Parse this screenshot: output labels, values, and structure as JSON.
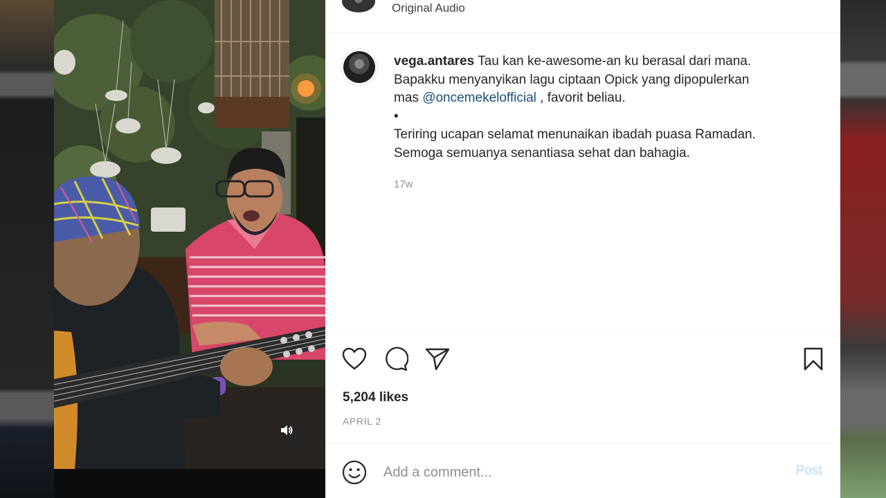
{
  "header": {
    "audio_label": "Original Audio"
  },
  "caption": {
    "username": "vega.antares",
    "line1": " Tau kan ke-awesome-an ku berasal dari mana.",
    "line2": "Bapakku menyanyikan lagu ciptaan Opick yang dipopulerkan",
    "line3_pre": "mas ",
    "mention": "@oncemekelofficial",
    "line3_post": " , favorit beliau.",
    "bullet": "•",
    "line5": "Teriring ucapan selamat menunaikan ibadah puasa Ramadan.",
    "line6": "Semoga semuanya senantiasa sehat dan bahagia.",
    "time_ago": "17w"
  },
  "actions": {
    "like_icon": "heart-icon",
    "comment_icon": "comment-icon",
    "share_icon": "paper-plane-icon",
    "save_icon": "bookmark-icon",
    "likes": "5,204 likes",
    "date": "APRIL 2"
  },
  "comment": {
    "emoji_icon": "smiley-icon",
    "placeholder": "Add a comment...",
    "post_label": "Post"
  },
  "video": {
    "sound_icon": "speaker-icon"
  },
  "colors": {
    "mention": "#1a4f7a",
    "post_disabled": "#b3dbff",
    "muted_text": "#8e8e8e"
  }
}
